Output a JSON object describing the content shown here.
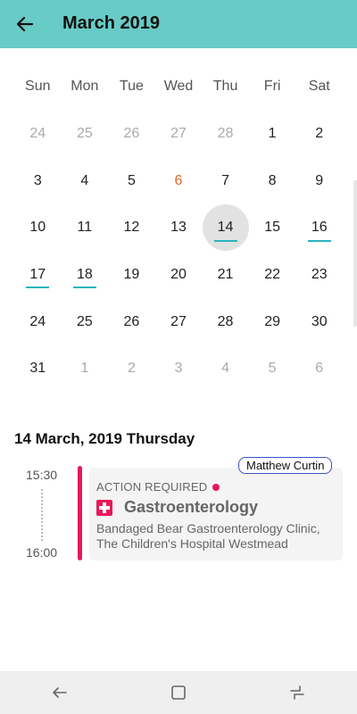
{
  "header": {
    "title": "March 2019",
    "back_icon": "arrow-left-icon"
  },
  "calendar": {
    "weekdays": [
      "Sun",
      "Mon",
      "Tue",
      "Wed",
      "Thu",
      "Fri",
      "Sat"
    ],
    "days": [
      {
        "label": "24",
        "muted": true
      },
      {
        "label": "25",
        "muted": true
      },
      {
        "label": "26",
        "muted": true
      },
      {
        "label": "27",
        "muted": true
      },
      {
        "label": "28",
        "muted": true
      },
      {
        "label": "1"
      },
      {
        "label": "2"
      },
      {
        "label": "3"
      },
      {
        "label": "4"
      },
      {
        "label": "5"
      },
      {
        "label": "6",
        "today": true
      },
      {
        "label": "7"
      },
      {
        "label": "8"
      },
      {
        "label": "9"
      },
      {
        "label": "10"
      },
      {
        "label": "11"
      },
      {
        "label": "12"
      },
      {
        "label": "13"
      },
      {
        "label": "14",
        "selected": true,
        "event": true
      },
      {
        "label": "15"
      },
      {
        "label": "16",
        "event": true
      },
      {
        "label": "17",
        "event": true
      },
      {
        "label": "18",
        "event": true
      },
      {
        "label": "19"
      },
      {
        "label": "20"
      },
      {
        "label": "21"
      },
      {
        "label": "22"
      },
      {
        "label": "23"
      },
      {
        "label": "24"
      },
      {
        "label": "25"
      },
      {
        "label": "26"
      },
      {
        "label": "27"
      },
      {
        "label": "28"
      },
      {
        "label": "29"
      },
      {
        "label": "30"
      },
      {
        "label": "31"
      },
      {
        "label": "1",
        "muted": true
      },
      {
        "label": "2",
        "muted": true
      },
      {
        "label": "3",
        "muted": true
      },
      {
        "label": "4",
        "muted": true
      },
      {
        "label": "5",
        "muted": true
      },
      {
        "label": "6",
        "muted": true
      }
    ],
    "colors": {
      "today": "#e8622b",
      "event_marker": "#2bb5bd",
      "selected_bg": "#e2e2e2"
    }
  },
  "selected_date_label": "14 March, 2019 Thursday",
  "appointment": {
    "start_time": "15:30",
    "end_time": "16:00",
    "patient": "Matthew Curtin",
    "status": "ACTION REQUIRED",
    "title": "Gastroenterology",
    "location": "Bandaged Bear Gastroenterology Clinic, The Children's Hospital Westmead",
    "icon": "hospital-cross-icon",
    "accent_color": "#e6195b"
  },
  "colors": {
    "appbar": "#69cbc6",
    "accent": "#e6195b"
  },
  "system_nav": {
    "back_icon": "nav-back-icon",
    "home_icon": "nav-home-icon",
    "recents_icon": "nav-recents-icon"
  }
}
